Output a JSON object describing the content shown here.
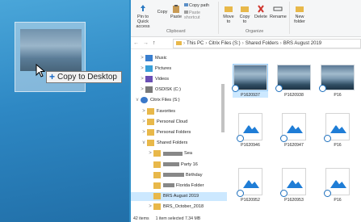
{
  "drag": {
    "tooltip_symbol": "+",
    "tooltip_label": "Copy to Desktop"
  },
  "ribbon": {
    "pin_label": "Pin to Quick access",
    "copy_label": "Copy",
    "paste_label": "Paste",
    "copy_path_label": "Copy path",
    "paste_shortcut_label": "Paste shortcut",
    "move_to_label": "Move to",
    "copy_to_label": "Copy to",
    "delete_label": "Delete",
    "rename_label": "Rename",
    "new_folder_label": "New folder",
    "clipboard_group": "Clipboard",
    "organize_group": "Organize"
  },
  "address": {
    "crumbs": [
      "This PC",
      "Citrix Files (S:)",
      "Shared Folders",
      "BRS August 2019"
    ]
  },
  "nav": {
    "items": [
      {
        "label": "Music",
        "chev": ">",
        "icon": "music-icon"
      },
      {
        "label": "Pictures",
        "chev": ">",
        "icon": "pictures-icon"
      },
      {
        "label": "Videos",
        "chev": ">",
        "icon": "videos-icon"
      },
      {
        "label": "OSDISK (C:)",
        "chev": ">",
        "icon": "drive-icon"
      },
      {
        "label": "Citrix Files (S:)",
        "chev": "v",
        "icon": "citrix-icon"
      },
      {
        "label": "Favorites",
        "chev": ">",
        "icon": "folder-icon"
      },
      {
        "label": "Personal Cloud",
        "chev": ">",
        "icon": "folder-icon"
      },
      {
        "label": "Personal Folders",
        "chev": ">",
        "icon": "folder-icon"
      },
      {
        "label": "Shared Folders",
        "chev": "v",
        "icon": "folder-icon"
      },
      {
        "label": "Sea",
        "chev": ">",
        "icon": "folder-icon"
      },
      {
        "label": "Party 16",
        "chev": "",
        "icon": "folder-icon"
      },
      {
        "label": "Birthday",
        "chev": "",
        "icon": "folder-icon"
      },
      {
        "label": "Florida Folder",
        "chev": "",
        "icon": "folder-icon"
      },
      {
        "label": "BRS August 2019",
        "chev": "",
        "icon": "folder-icon"
      },
      {
        "label": "BRS_October_2018",
        "chev": ">",
        "icon": "folder-icon"
      }
    ]
  },
  "files": {
    "row1": [
      "P1620937",
      "P1620938",
      "P16"
    ],
    "row2": [
      "P1620946",
      "P1620947",
      "P16"
    ],
    "row3": [
      "P1620952",
      "P1620953",
      "P16"
    ]
  },
  "status": {
    "count": "42 items",
    "selection": "1 item selected  7.34 MB"
  },
  "colors": {
    "selection": "#cce8ff",
    "accent": "#1c6fbd"
  }
}
